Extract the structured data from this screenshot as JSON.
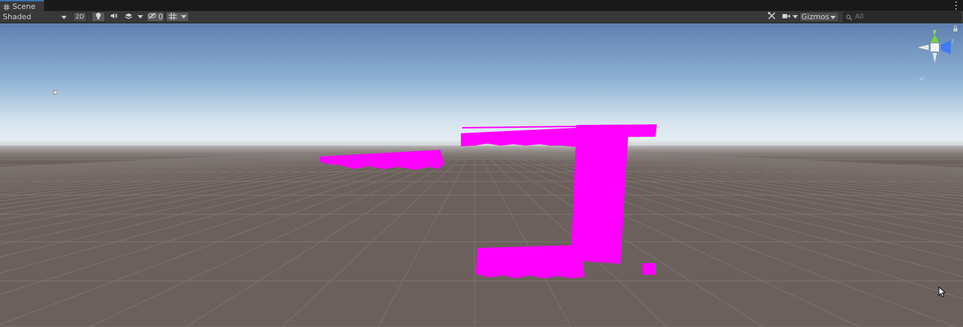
{
  "tab": {
    "label": "Scene",
    "icon": "grid-icon"
  },
  "toolbar": {
    "draw_mode": "Shaded",
    "mode_2d": "2D",
    "hidden_count": "0",
    "gizmos_label": "Gizmos",
    "search_placeholder": "All"
  },
  "colors": {
    "tab_accent": "#3a72b0",
    "missing_material": "#ff00ff",
    "gizmo_y": "#7ad13a",
    "gizmo_z": "#3e7cf0",
    "ground": "#6b605c",
    "sky_top": "#5e7fae",
    "horizon": "#e8eef3"
  },
  "icons": [
    "grid-icon",
    "lightbulb-icon",
    "audio-icon",
    "effects-icon",
    "visibility-icon",
    "grid-snap-icon",
    "tools-icon",
    "camera-icon",
    "search-icon",
    "lock-icon",
    "mouse-cursor-icon"
  ],
  "gizmo_axes": {
    "y": "y",
    "z": "z"
  }
}
